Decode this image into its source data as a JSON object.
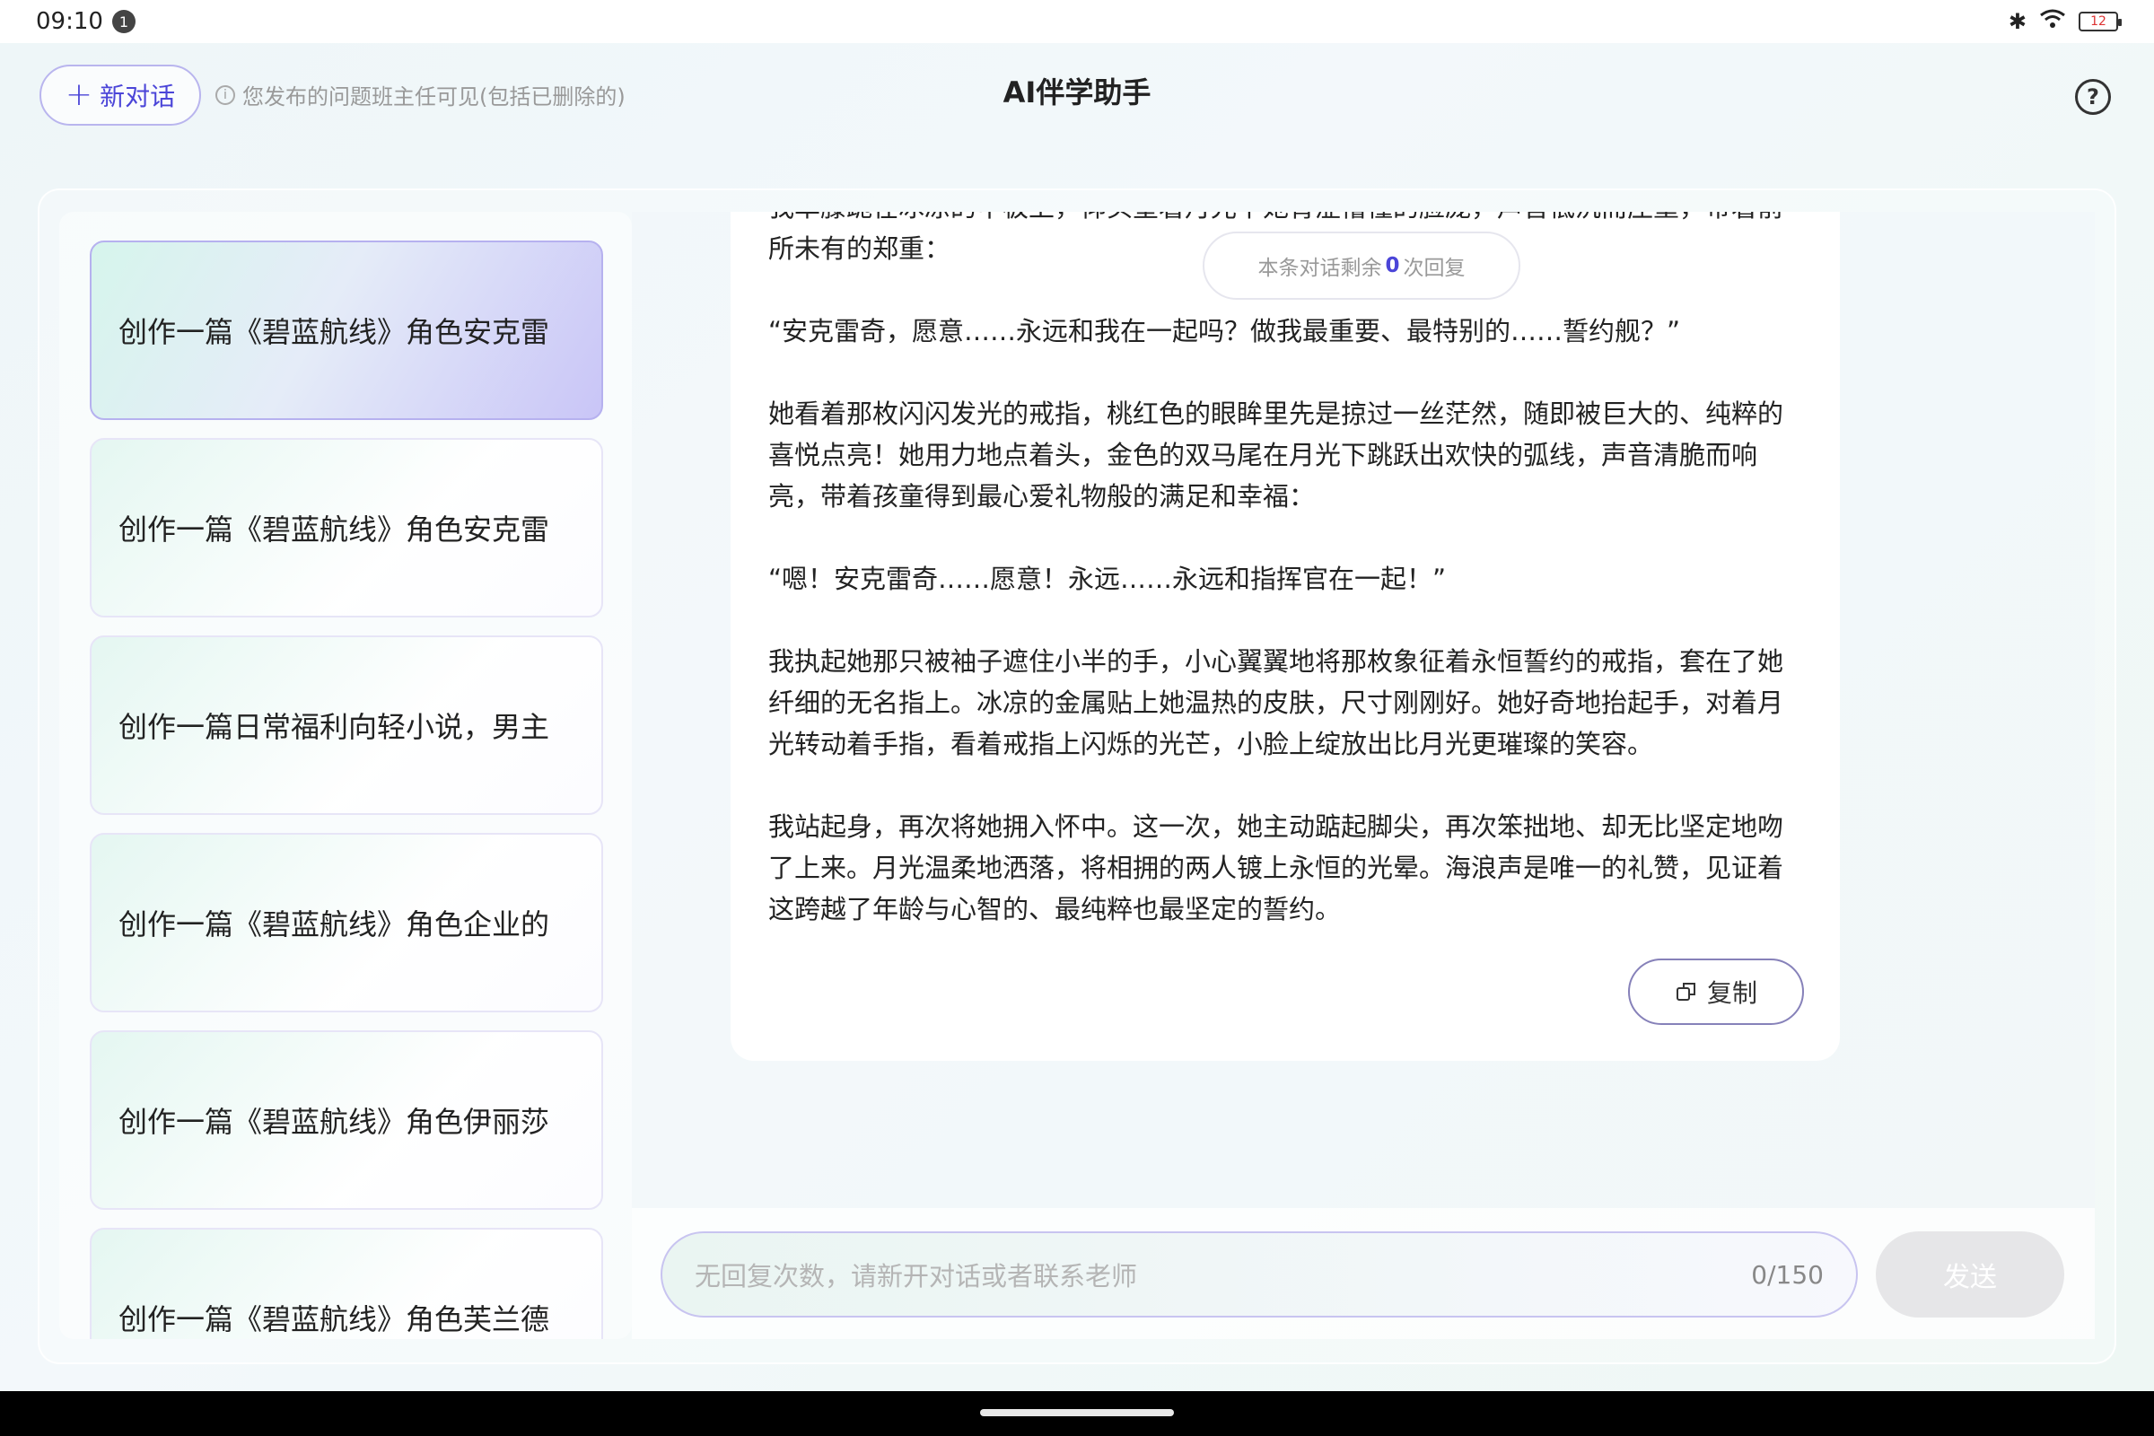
{
  "status_bar": {
    "time": "09:10",
    "notification_count": "1",
    "battery": "12"
  },
  "header": {
    "new_chat_label": "新对话",
    "notice": "您发布的问题班主任可见(包括已删除的)",
    "title": "AI伴学助手"
  },
  "sidebar": {
    "items": [
      {
        "label": "创作一篇《碧蓝航线》角色安克雷"
      },
      {
        "label": "创作一篇《碧蓝航线》角色安克雷"
      },
      {
        "label": "创作一篇日常福利向轻小说，男主"
      },
      {
        "label": "创作一篇《碧蓝航线》角色企业的"
      },
      {
        "label": "创作一篇《碧蓝航线》角色伊丽莎"
      },
      {
        "label": "创作一篇《碧蓝航线》角色芙兰德"
      }
    ]
  },
  "chat": {
    "remaining": {
      "prefix": "本条对话剩余",
      "count": "0",
      "suffix": "次回复"
    },
    "paragraphs": [
      "我单膝跪在冰凉的甲板上，仰头望着月光下她青涩懵懂的脸庞，声音低沉而庄重，带着前所未有的郑重：",
      "“安克雷奇，愿意……永远和我在一起吗？做我最重要、最特别的……誓约舰？”",
      "她看着那枚闪闪发光的戒指，桃红色的眼眸里先是掠过一丝茫然，随即被巨大的、纯粹的喜悦点亮！她用力地点着头，金色的双马尾在月光下跳跃出欢快的弧线，声音清脆而响亮，带着孩童得到最心爱礼物般的满足和幸福：",
      "“嗯！安克雷奇……愿意！永远……永远和指挥官在一起！”",
      "我执起她那只被袖子遮住小半的手，小心翼翼地将那枚象征着永恒誓约的戒指，套在了她纤细的无名指上。冰凉的金属贴上她温热的皮肤，尺寸刚刚好。她好奇地抬起手，对着月光转动着手指，看着戒指上闪烁的光芒，小脸上绽放出比月光更璀璨的笑容。",
      "我站起身，再次将她拥入怀中。这一次，她主动踮起脚尖，再次笨拙地、却无比坚定地吻了上来。月光温柔地洒落，将相拥的两人镀上永恒的光晕。海浪声是唯一的礼赞，见证着这跨越了年龄与心智的、最纯粹也最坚定的誓约。"
    ],
    "copy_label": "复制"
  },
  "input": {
    "placeholder": "无回复次数，请新开对话或者联系老师",
    "counter": "0/150",
    "send_label": "发送"
  },
  "colors": {
    "accent": "#4b45d8",
    "active_item_border": "#b6b1ef",
    "send_disabled": "#e6e6e8"
  }
}
